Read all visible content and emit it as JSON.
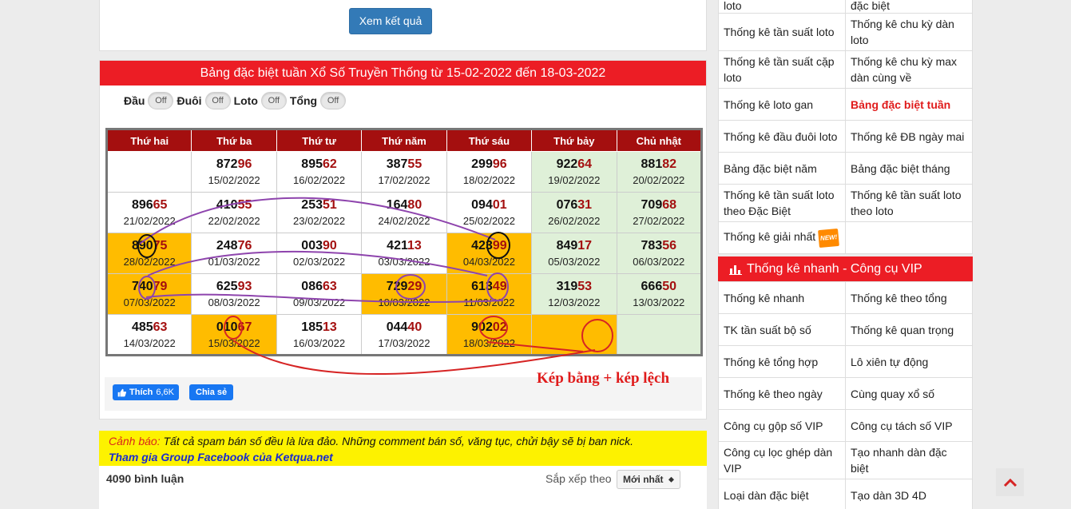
{
  "search": {
    "button_label": "Xem kết quả"
  },
  "panel": {
    "title": "Bảng đặc biệt tuần Xổ Số Truyền Thống từ 15-02-2022 đến 18-03-2022",
    "toggles": [
      {
        "label": "Đầu",
        "state": "Off"
      },
      {
        "label": "Đuôi",
        "state": "Off"
      },
      {
        "label": "Loto",
        "state": "Off"
      },
      {
        "label": "Tổng",
        "state": "Off"
      }
    ],
    "headers": [
      "Thứ hai",
      "Thứ ba",
      "Thứ tư",
      "Thứ năm",
      "Thứ sáu",
      "Thứ bảy",
      "Chủ nhật"
    ],
    "rows": [
      [
        {
          "head": "",
          "tail": "",
          "date": "",
          "bg": "white"
        },
        {
          "head": "872",
          "tail": "96",
          "date": "15/02/2022",
          "bg": "white"
        },
        {
          "head": "895",
          "tail": "62",
          "date": "16/02/2022",
          "bg": "white"
        },
        {
          "head": "387",
          "tail": "55",
          "date": "17/02/2022",
          "bg": "white"
        },
        {
          "head": "299",
          "tail": "96",
          "date": "18/02/2022",
          "bg": "white"
        },
        {
          "head": "922",
          "tail": "64",
          "date": "19/02/2022",
          "bg": "green"
        },
        {
          "head": "881",
          "tail": "82",
          "date": "20/02/2022",
          "bg": "green"
        }
      ],
      [
        {
          "head": "896",
          "tail": "65",
          "date": "21/02/2022",
          "bg": "white"
        },
        {
          "head": "410",
          "tail": "55",
          "date": "22/02/2022",
          "bg": "white"
        },
        {
          "head": "253",
          "tail": "51",
          "date": "23/02/2022",
          "bg": "white"
        },
        {
          "head": "164",
          "tail": "80",
          "date": "24/02/2022",
          "bg": "white"
        },
        {
          "head": "094",
          "tail": "01",
          "date": "25/02/2022",
          "bg": "white"
        },
        {
          "head": "076",
          "tail": "31",
          "date": "26/02/2022",
          "bg": "green"
        },
        {
          "head": "709",
          "tail": "68",
          "date": "27/02/2022",
          "bg": "green"
        }
      ],
      [
        {
          "head": "890",
          "tail": "75",
          "date": "28/02/2022",
          "bg": "orange"
        },
        {
          "head": "248",
          "tail": "76",
          "date": "01/03/2022",
          "bg": "white"
        },
        {
          "head": "003",
          "tail": "90",
          "date": "02/03/2022",
          "bg": "white"
        },
        {
          "head": "421",
          "tail": "13",
          "date": "03/03/2022",
          "bg": "white"
        },
        {
          "head": "423",
          "tail": "99",
          "date": "04/03/2022",
          "bg": "orange"
        },
        {
          "head": "849",
          "tail": "17",
          "date": "05/03/2022",
          "bg": "green"
        },
        {
          "head": "783",
          "tail": "56",
          "date": "06/03/2022",
          "bg": "green"
        }
      ],
      [
        {
          "head": "740",
          "tail": "79",
          "date": "07/03/2022",
          "bg": "orange"
        },
        {
          "head": "625",
          "tail": "93",
          "date": "08/03/2022",
          "bg": "white"
        },
        {
          "head": "086",
          "tail": "63",
          "date": "09/03/2022",
          "bg": "white"
        },
        {
          "head": "729",
          "tail": "29",
          "date": "10/03/2022",
          "bg": "orange"
        },
        {
          "head": "613",
          "tail": "49",
          "date": "11/03/2022",
          "bg": "orange"
        },
        {
          "head": "319",
          "tail": "53",
          "date": "12/03/2022",
          "bg": "green"
        },
        {
          "head": "666",
          "tail": "50",
          "date": "13/03/2022",
          "bg": "green"
        }
      ],
      [
        {
          "head": "485",
          "tail": "63",
          "date": "14/03/2022",
          "bg": "white"
        },
        {
          "head": "010",
          "tail": "67",
          "date": "15/03/2022",
          "bg": "orange"
        },
        {
          "head": "185",
          "tail": "13",
          "date": "16/03/2022",
          "bg": "white"
        },
        {
          "head": "044",
          "tail": "40",
          "date": "17/03/2022",
          "bg": "white"
        },
        {
          "head": "902",
          "tail": "02",
          "date": "18/03/2022",
          "bg": "orange"
        },
        {
          "head": "",
          "tail": "",
          "date": "",
          "bg": "orange"
        },
        {
          "head": "",
          "tail": "",
          "date": "",
          "bg": "green"
        }
      ]
    ],
    "annotation": "Kép bằng + kép lệch",
    "facebook": {
      "like_label": "Thích",
      "like_count": "6,6K",
      "share_label": "Chia sẻ"
    }
  },
  "warning": {
    "label": "Cảnh báo:",
    "text": " Tất cả spam bán số đều là lừa đảo. Những comment bán số, văng tục, chửi bậy sẽ bị ban nick.",
    "link": "Tham gia Group Facebook của Ketqua.net"
  },
  "comments": {
    "count": "4090 bình luận",
    "sort_label": "Sắp xếp theo",
    "sort_value": "Mới nhất"
  },
  "sidebar_top": {
    "top_partial": [
      "loto",
      "đặc biệt"
    ],
    "rows": [
      [
        "Thống kê tần suất loto",
        "Thống kê chu kỳ dàn loto"
      ],
      [
        "Thống kê tần suất cặp loto",
        "Thống kê chu kỳ max dàn cùng về"
      ],
      [
        "Thống kê loto gan",
        "Bảng đặc biệt tuần"
      ],
      [
        "Thống kê đầu đuôi loto",
        "Thống kê ĐB ngày mai"
      ],
      [
        "Bảng đặc biệt năm",
        "Bảng đặc biệt tháng"
      ],
      [
        "Thống kê tần suất loto theo Đặc Biệt",
        "Thống kê tần suất loto theo loto"
      ],
      [
        "Thống kê giải nhất",
        ""
      ]
    ],
    "new_badge": "NEW!"
  },
  "sidebar_vip": {
    "title": "Thống kê nhanh - Công cụ VIP",
    "rows": [
      [
        "Thống kê nhanh",
        "Thống kê theo tổng"
      ],
      [
        "TK tần suất bộ số",
        "Thống kê quan trọng"
      ],
      [
        "Thống kê tổng hợp",
        "Lô xiên tự động"
      ],
      [
        "Thống kê theo ngày",
        "Cùng quay xổ số"
      ],
      [
        "Công cụ gộp số VIP",
        "Công cụ tách số VIP"
      ],
      [
        "Công cụ lọc ghép dàn VIP",
        "Tạo nhanh dàn đặc biệt"
      ],
      [
        "Loại dàn đặc biệt",
        "Tạo dàn 3D 4D"
      ]
    ]
  },
  "colors": {
    "red": "#ec1d25",
    "dark_red": "#a40f0f",
    "orange": "#ffbc00",
    "green": "#dff0d8",
    "blue": "#337ab7"
  },
  "icons": {
    "chart": "bar-chart-icon",
    "scroll_top": "chevron-up-icon",
    "facebook": "thumbs-up-icon"
  }
}
